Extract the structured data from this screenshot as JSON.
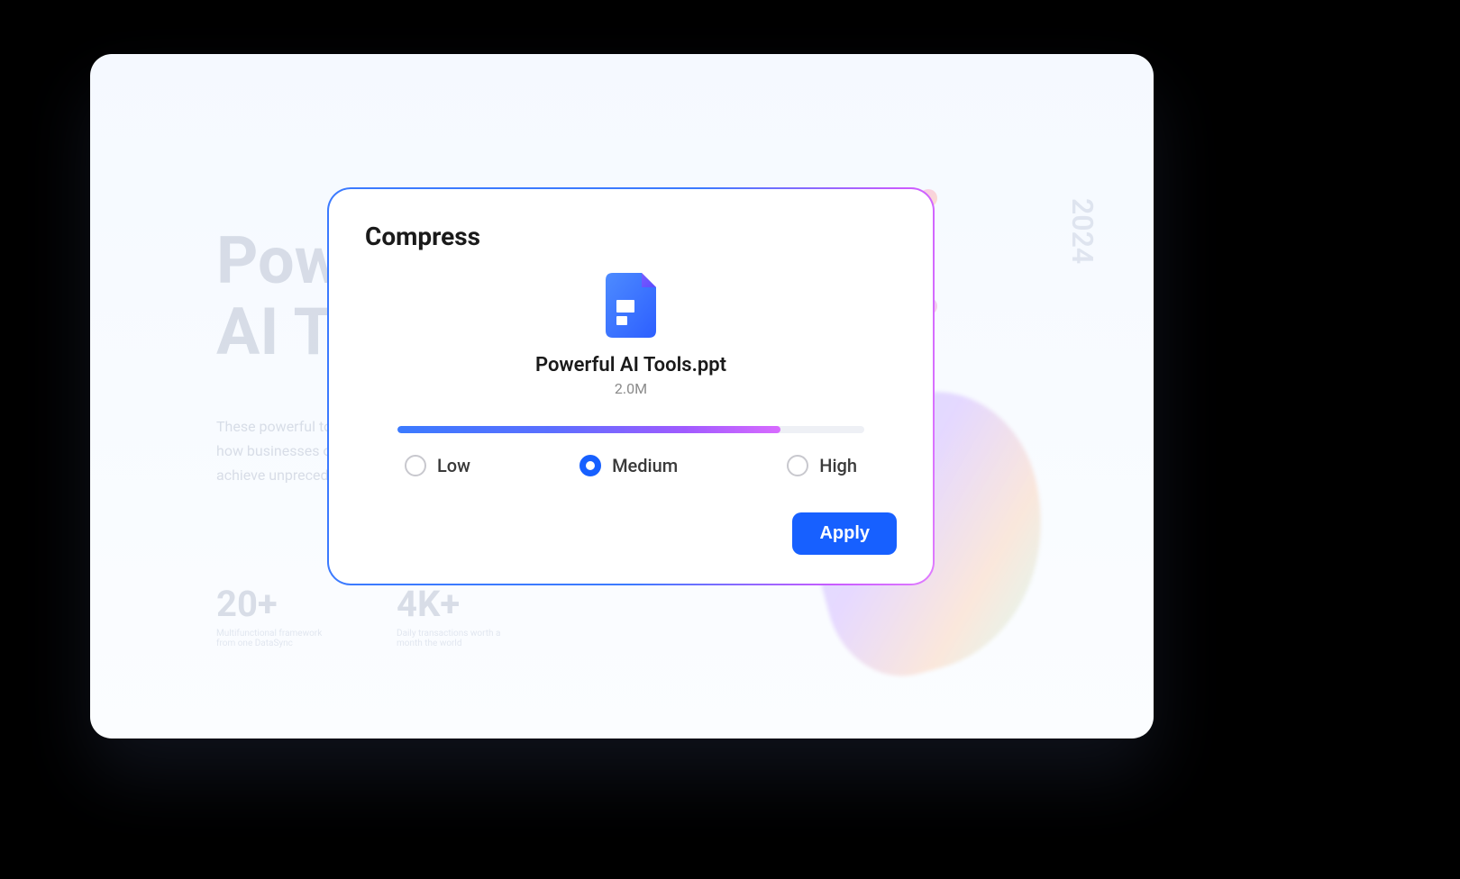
{
  "background": {
    "title_line1": "Powerful",
    "title_line2": "AI Tools",
    "paragraph": "These powerful tools are driving a fundamental shift in how businesses operate, harnessing technology to achieve unprecedented levels of innovation.",
    "stats": [
      {
        "value": "20+",
        "label": "Multifunctional framework from one DataSync"
      },
      {
        "value": "4K+",
        "label": "Daily transactions worth a month the world"
      }
    ],
    "year": "2024"
  },
  "modal": {
    "title": "Compress",
    "file": {
      "icon": "file-document-icon",
      "name": "Powerful AI Tools.ppt",
      "size": "2.0M"
    },
    "slider": {
      "fill_percent": 82
    },
    "options": [
      {
        "id": "low",
        "label": "Low",
        "selected": false
      },
      {
        "id": "medium",
        "label": "Medium",
        "selected": true
      },
      {
        "id": "high",
        "label": "High",
        "selected": false
      }
    ],
    "apply_label": "Apply"
  },
  "colors": {
    "accent": "#1760ff",
    "gradient_start": "#3b7aff",
    "gradient_end": "#d86bff"
  }
}
